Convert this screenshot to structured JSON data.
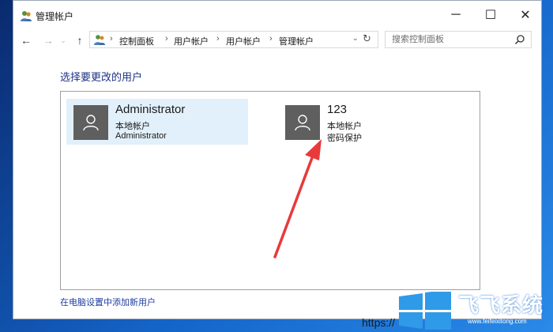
{
  "window": {
    "title": "管理帐户"
  },
  "controls": {
    "minimize": "─",
    "maximize": "☐",
    "close": "✕"
  },
  "nav": {
    "back": "←",
    "forward": "→",
    "recent": "⌄",
    "up": "↑"
  },
  "breadcrumb": [
    "控制面板",
    "用户帐户",
    "用户帐户",
    "管理帐户"
  ],
  "breadcrumb_separator": "›",
  "search": {
    "placeholder": "搜索控制面板"
  },
  "heading": "选择要更改的用户",
  "accounts": [
    {
      "name": "Administrator",
      "type": "本地帐户",
      "detail": "Administrator",
      "selected": true
    },
    {
      "name": "123",
      "type": "本地帐户",
      "detail": "密码保护",
      "selected": false
    }
  ],
  "add_user_link": "在电脑设置中添加新用户",
  "watermark": {
    "text": "飞飞系统",
    "url": "https://",
    "url_small": "www.feifeixitong.com"
  },
  "colors": {
    "heading": "#1e3287",
    "link": "#1e3ca0",
    "selected_bg": "#e2f0fb",
    "avatar_bg": "#5f5f5f",
    "arrow": "#e83a3a",
    "desktop": "#1464c8"
  },
  "icons": {
    "title": "user-accounts-icon",
    "address": "user-accounts-icon",
    "search": "search-icon",
    "refresh": "refresh-icon",
    "avatar": "user-silhouette-icon"
  }
}
